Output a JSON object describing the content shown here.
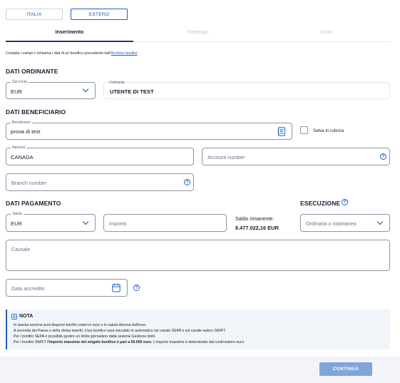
{
  "tabs": {
    "italia": "ITALIA",
    "estero": "ESTERO",
    "active": "estero"
  },
  "steps": [
    {
      "label": "Inserimento",
      "state": "active"
    },
    {
      "label": "Riepilogo",
      "state": "inactive"
    },
    {
      "label": "Esito",
      "state": "inactive"
    }
  ],
  "hint": {
    "text": "Compila i campi o richiama i dati di un bonifico precedente dall'",
    "link": "Archivio bonifici"
  },
  "ordinante": {
    "section_title": "DATI ORDINANTE",
    "conto_label": "Dal conto",
    "conto_value": "EUR",
    "ordinante_label": "Ordinante",
    "ordinante_value": "UTENTE DI TEST"
  },
  "beneficiario": {
    "section_title": "DATI BENEFICIARIO",
    "beneficiario_label": "Beneficiario",
    "beneficiario_value": "prova di test",
    "salva_label": "Salva in rubrica",
    "nazione_label": "Nazione",
    "nazione_value": "CANADA",
    "account_placeholder": "Account number",
    "branch_placeholder": "Branch number"
  },
  "pagamento": {
    "section_title": "DATI PAGAMENTO",
    "valuta_label": "Valuta",
    "valuta_value": "EUR",
    "importo_placeholder": "Importo",
    "saldo_label": "Saldo rimanente:",
    "saldo_value": "8.477.022,16 EUR",
    "esecuzione_title": "ESECUZIONE",
    "esecuzione_placeholder": "Ordinaria o istantanea",
    "causale_placeholder": "Causale",
    "data_placeholder": "Data accredito"
  },
  "nota": {
    "title": "NOTA",
    "line1": "In questa sezione puoi disporre bonifici esteri in euro o in valuta diversa dall'euro.",
    "line2": "A seconda del Paese e della divisa inseriti, il tuo bonifico sarà veicolato in automatico sul canale SEPA o sul canale estero SWIFT.",
    "line3": "Per i bonifici SEPA è possibile gestire un limite giornaliero dalla sezione Gestione limiti.",
    "line4_pre": "Per i bonifici SWIFT ",
    "line4_bold": "l'importo massimo del singolo bonifico è pari a 50.000 euro",
    "line4_post": ". L'importo massimo è determinato dal controvalore euro."
  },
  "footer": {
    "continue_label": "CONTINUA"
  },
  "colors": {
    "accent": "#1f5fbf",
    "active_step": "#1f3a6e",
    "button_disabled": "#7fa6d6"
  }
}
